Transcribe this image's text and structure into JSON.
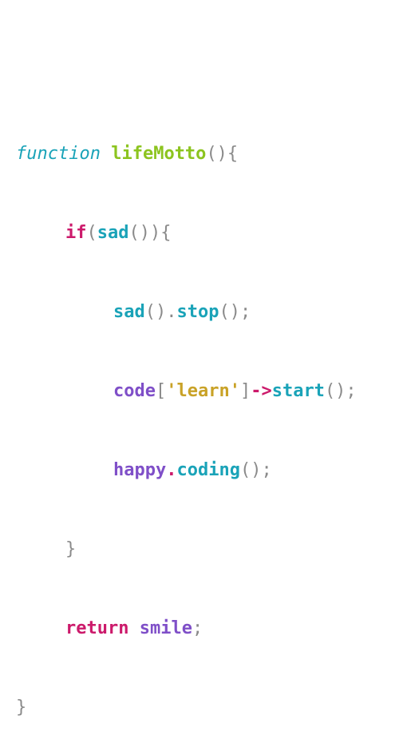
{
  "code": {
    "line1": {
      "keyword": "function",
      "name": "lifeMotto",
      "punct": "(){"
    },
    "line2": {
      "keyword": "if",
      "open": "(",
      "call": "sad",
      "close": "()){"
    },
    "line3": {
      "call": "sad",
      "mid": "().",
      "method": "stop",
      "end": "();"
    },
    "line4": {
      "obj": "code",
      "lb": "[",
      "string": "'learn'",
      "rb": "]",
      "arrow": "->",
      "method": "start",
      "end": "();"
    },
    "line5": {
      "obj": "happy",
      "dot": ".",
      "method": "coding",
      "end": "();"
    },
    "line6": {
      "brace": "}"
    },
    "line7": {
      "keyword": "return",
      "value": "smile",
      "end": ";"
    },
    "line8": {
      "brace": "}"
    }
  }
}
